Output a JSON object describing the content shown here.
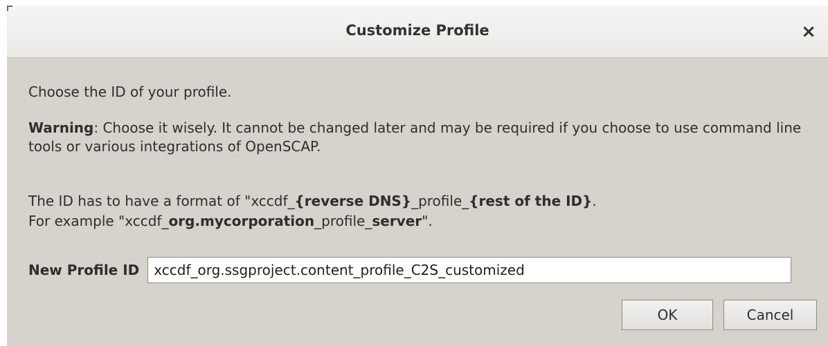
{
  "dialog": {
    "title": "Customize Profile",
    "close_label": "×"
  },
  "message": {
    "intro": "Choose the ID of your profile.",
    "warning_label": "Warning",
    "warning_text": ": Choose it wisely. It cannot be changed later and may be required if you choose to use command line tools or various integrations of OpenSCAP.",
    "format_line": {
      "prefix": "The ID has to have a format of \"xccdf_",
      "part1": "{reverse DNS}",
      "middle": "_profile_",
      "part2": "{rest of the ID}",
      "suffix": "."
    },
    "example_line": {
      "prefix": "For example \"xccdf_",
      "part1": "org.mycorporation",
      "middle": "_profile_",
      "part2": "server",
      "suffix": "\"."
    }
  },
  "form": {
    "label": "New Profile ID",
    "value": "xccdf_org.ssgproject.content_profile_C2S_customized"
  },
  "buttons": {
    "ok": "OK",
    "cancel": "Cancel"
  }
}
